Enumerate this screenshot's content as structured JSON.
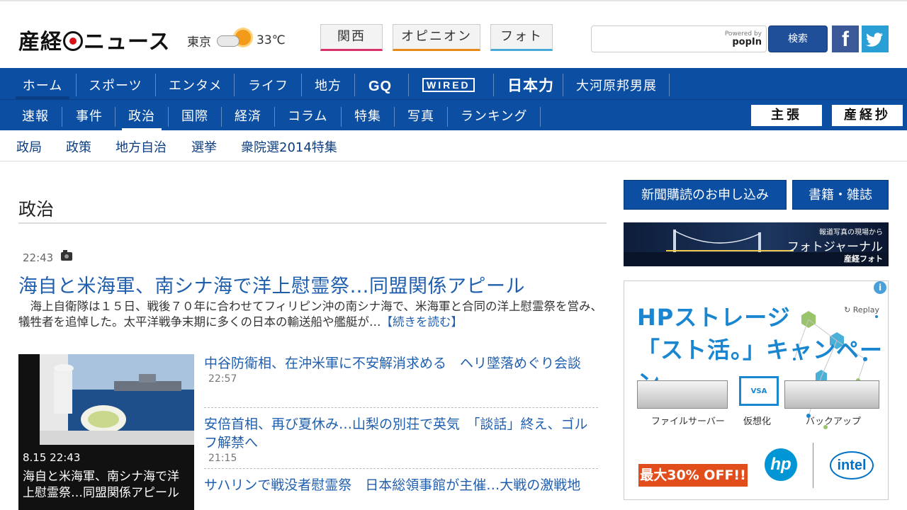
{
  "header": {
    "logo_text": "産経ニュース",
    "weather": {
      "city": "東京",
      "temp": "33℃",
      "icon": "cloud-sun-icon"
    },
    "tabs": [
      {
        "label": "関西",
        "accent": "#d8326a"
      },
      {
        "label": "オピニオン",
        "accent": "#e88a1a"
      },
      {
        "label": "フォト",
        "accent": "#4aaad8"
      }
    ],
    "search": {
      "placeholder": "",
      "powered_by": "Powered by",
      "provider": "popIn",
      "button": "検索"
    },
    "social": {
      "facebook": "f",
      "twitter_icon": "twitter-bird-icon"
    }
  },
  "nav_primary": [
    "ホーム",
    "スポーツ",
    "エンタメ",
    "ライフ",
    "地方",
    "GQ",
    "WIRED",
    "日本力",
    "大河原邦男展"
  ],
  "nav_secondary": {
    "items": [
      "速報",
      "事件",
      "政治",
      "国際",
      "経済",
      "コラム",
      "特集",
      "写真",
      "ランキング"
    ],
    "active": "政治",
    "right_buttons": [
      "主張",
      "産経抄"
    ]
  },
  "subnav": [
    "政局",
    "政策",
    "地方自治",
    "選挙",
    "衆院選2014特集"
  ],
  "main": {
    "section_title": "政治",
    "lead": {
      "time": "22:43",
      "title": "海自と米海軍、南シナ海で洋上慰霊祭…同盟関係アピール",
      "body": "海上自衛隊は１５日、戦後７０年に合わせてフィリピン沖の南シナ海で、米海軍と合同の洋上慰霊祭を営み、犠牲者を追悼した。太平洋戦争末期に多くの日本の輸送船や艦艇が…",
      "more": "【続きを読む】"
    },
    "photo_card": {
      "time": "8.15 22:43",
      "caption": "海自と米海軍、南シナ海で洋上慰霊祭…同盟関係アピール"
    },
    "news": [
      {
        "title": "中谷防衛相、在沖米軍に不安解消求める　ヘリ墜落めぐり会談",
        "time": "22:57"
      },
      {
        "title": "安倍首相、再び夏休み…山梨の別荘で英気　「談話」終え、ゴルフ解禁へ",
        "time": "21:15"
      },
      {
        "title": "サハリンで戦没者慰霊祭　日本総領事館が主催…大戦の激戦地",
        "time": ""
      }
    ]
  },
  "sidebar": {
    "buttons": [
      "新聞購読のお申し込み",
      "書籍・雑誌"
    ],
    "photo_banner": {
      "line1": "報道写真の現場から",
      "line2": "フォトジャーナル",
      "line3": "産経フォト"
    },
    "ad": {
      "headline1": "HPストレージ",
      "headline2": "「スト活。」キャンペーン",
      "replay": "Replay",
      "labels": [
        "ファイルサーバー",
        "仮想化",
        "バックアップ"
      ],
      "vsa": "VSA",
      "offer": "最大30% OFF!!",
      "hp": "hp",
      "intel": "intel"
    }
  }
}
